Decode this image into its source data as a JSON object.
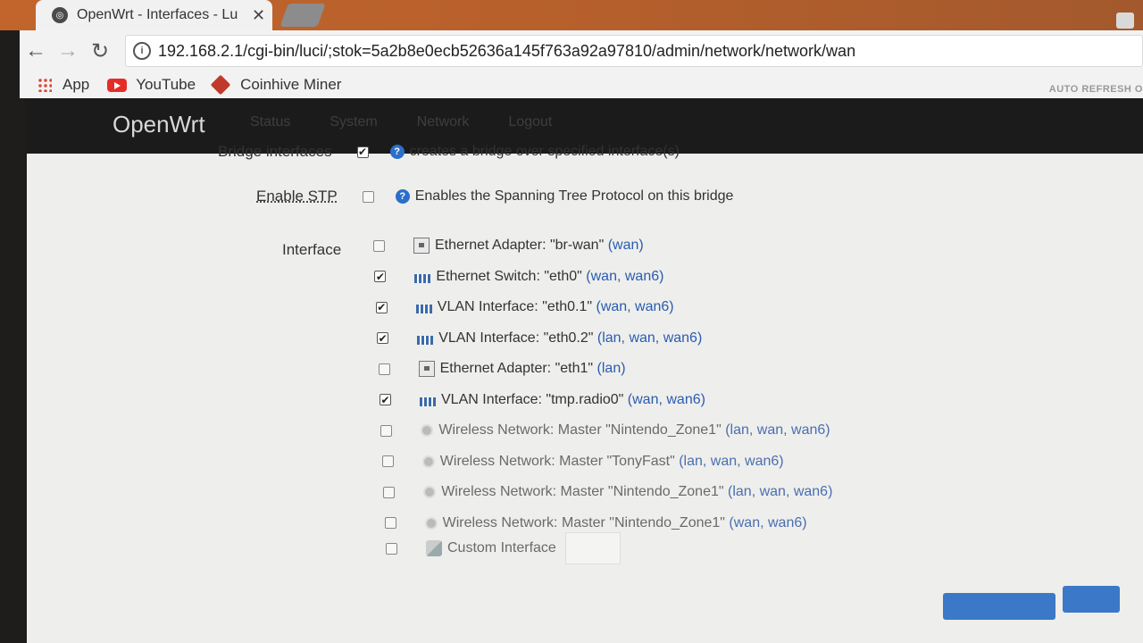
{
  "browser": {
    "tab_title": "OpenWrt - Interfaces - Lu",
    "url": "192.168.2.1/cgi-bin/luci/;stok=5a2b8e0ecb52636a145f763a92a97810/admin/network/network/wan",
    "bookmarks": [
      {
        "label": "App"
      },
      {
        "label": "YouTube"
      },
      {
        "label": "Coinhive Miner"
      }
    ]
  },
  "header": {
    "brand": "OpenWrt",
    "menu": [
      "Status",
      "System",
      "Network",
      "Logout"
    ],
    "auto_refresh": "AUTO REFRESH O"
  },
  "form": {
    "bridge": {
      "label": "Bridge interfaces",
      "checked": true,
      "help": "creates a bridge over specified interface(s)"
    },
    "stp": {
      "label": "Enable STP",
      "checked": false,
      "help": "Enables the Spanning Tree Protocol on this bridge"
    },
    "interface_label": "Interface",
    "interfaces": [
      {
        "name": "Ethernet Adapter: \"br-wan\"",
        "zones": "(wan)",
        "checked": false,
        "icon": "ethernet-adapter-icon"
      },
      {
        "name": "Ethernet Switch: \"eth0\"",
        "zones": "(wan, wan6)",
        "checked": true,
        "icon": "ethernet-switch-icon"
      },
      {
        "name": "VLAN Interface: \"eth0.1\"",
        "zones": "(wan, wan6)",
        "checked": true,
        "icon": "vlan-icon"
      },
      {
        "name": "VLAN Interface: \"eth0.2\"",
        "zones": "(lan, wan, wan6)",
        "checked": true,
        "icon": "vlan-icon"
      },
      {
        "name": "Ethernet Adapter: \"eth1\"",
        "zones": "(lan)",
        "checked": false,
        "icon": "ethernet-adapter-icon"
      },
      {
        "name": "VLAN Interface: \"tmp.radio0\"",
        "zones": "(wan, wan6)",
        "checked": true,
        "icon": "vlan-icon"
      },
      {
        "name": "Wireless Network: Master \"Nintendo_Zone1\"",
        "zones": "(lan, wan, wan6)",
        "checked": false,
        "icon": "wireless-icon"
      },
      {
        "name": "Wireless Network: Master \"TonyFast\"",
        "zones": "(lan, wan, wan6)",
        "checked": false,
        "icon": "wireless-icon"
      },
      {
        "name": "Wireless Network: Master \"Nintendo_Zone1\"",
        "zones": "(lan, wan, wan6)",
        "checked": false,
        "icon": "wireless-icon"
      },
      {
        "name": "Wireless Network: Master \"Nintendo_Zone1\"",
        "zones": "(wan, wan6)",
        "checked": false,
        "icon": "wireless-icon"
      }
    ],
    "custom_interface_label": "Custom Interface"
  }
}
